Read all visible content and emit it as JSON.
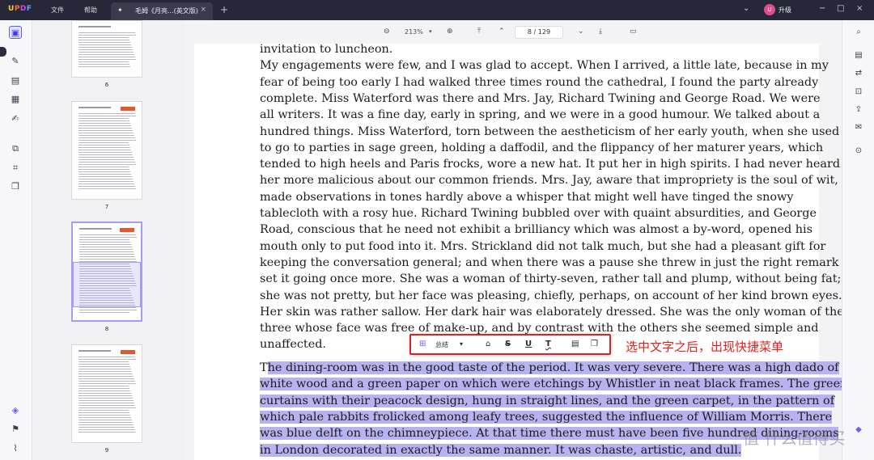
{
  "titlebar": {
    "logo": "UPDF",
    "menu": [
      "文件",
      "帮助"
    ],
    "tab_title": "毛姆《月亮...(英文版)",
    "tab_close": "×",
    "new_tab": "+",
    "user_initial": "U",
    "upgrade_label": "升级",
    "window_controls": [
      "−",
      "□",
      "×"
    ]
  },
  "view_toolbar": {
    "zoom": "213%",
    "current_page": "8",
    "page_separator": "/",
    "total_pages": "129"
  },
  "thumbnails": {
    "pages": [
      {
        "number": "6"
      },
      {
        "number": "7"
      },
      {
        "number": "8",
        "selected": true
      },
      {
        "number": "9"
      }
    ]
  },
  "document": {
    "lines": [
      "invitation to luncheon.",
      "My engagements were few, and I was glad to accept. When I arrived, a little late, because in my",
      "fear of being too early I had walked three times round the cathedral, I found the party already",
      "complete. Miss Waterford was there and Mrs. Jay, Richard Twining and George Road. We were",
      "all writers. It was a fine day, early in spring, and we were in a good humour. We talked about a",
      "hundred things. Miss Waterford, torn between the aestheticism of her early youth, when she used",
      "to go to parties in sage green, holding a daffodil, and the flippancy of her maturer years, which",
      "tended to high heels and Paris frocks, wore a new hat. It put her in high spirits. I had never heard",
      "her more malicious about our common friends. Mrs. Jay, aware that impropriety is the soul of wit,",
      "made observations in tones hardly above a whisper that might well have tinged the snowy",
      "tablecloth with a rosy hue. Richard Twining bubbled over with quaint absurdities, and George",
      "Road, conscious that he need not exhibit a brilliancy which was almost a by-word, opened his",
      "mouth only to put food into it. Mrs. Strickland did not talk much, but she had a pleasant gift for",
      "keeping the conversation general; and when there was a pause she threw in just the right remark to",
      "set it going once more. She was a woman of thirty-seven, rather tall and plump, without being fat;",
      "she was not pretty, but her face was pleasing, chiefly, perhaps, on account of her kind brown eyes.",
      "Her skin was rather sallow. Her dark hair was elaborately dressed. She was the only woman of the",
      "three whose face was free of make-up, and by contrast with the others she seemed simple and",
      "unaffected."
    ],
    "highlighted_first_char": "T",
    "highlighted_lines": [
      "he dining-room was in the good taste of the period. It was very severe. There was a high dado of",
      "white wood and a green paper on which were etchings by Whistler in neat black frames. The green",
      "curtains with their peacock design, hung in straight lines, and the green carpet, in the pattern of",
      "which pale rabbits frolicked among leafy trees, suggested the influence of William Morris. There",
      "was blue delft on the chimneypiece. At that time there must have been five hundred dining-rooms",
      "in London decorated in exactly the same manner. It was chaste, artistic, and dull."
    ]
  },
  "quick_menu": {
    "summary_label": "总结",
    "tools": [
      "highlight-icon",
      "strikethrough-icon",
      "underline-icon",
      "squiggly-icon",
      "comment-icon",
      "copy-icon"
    ]
  },
  "annotation": {
    "text": "选中文字之后，出现快捷菜单",
    "color": "#e02020"
  },
  "watermark": "值 什么值得买",
  "colors": {
    "selection": "#b7b3f0",
    "accent": "#5b5bff",
    "titlebar": "#262838"
  }
}
